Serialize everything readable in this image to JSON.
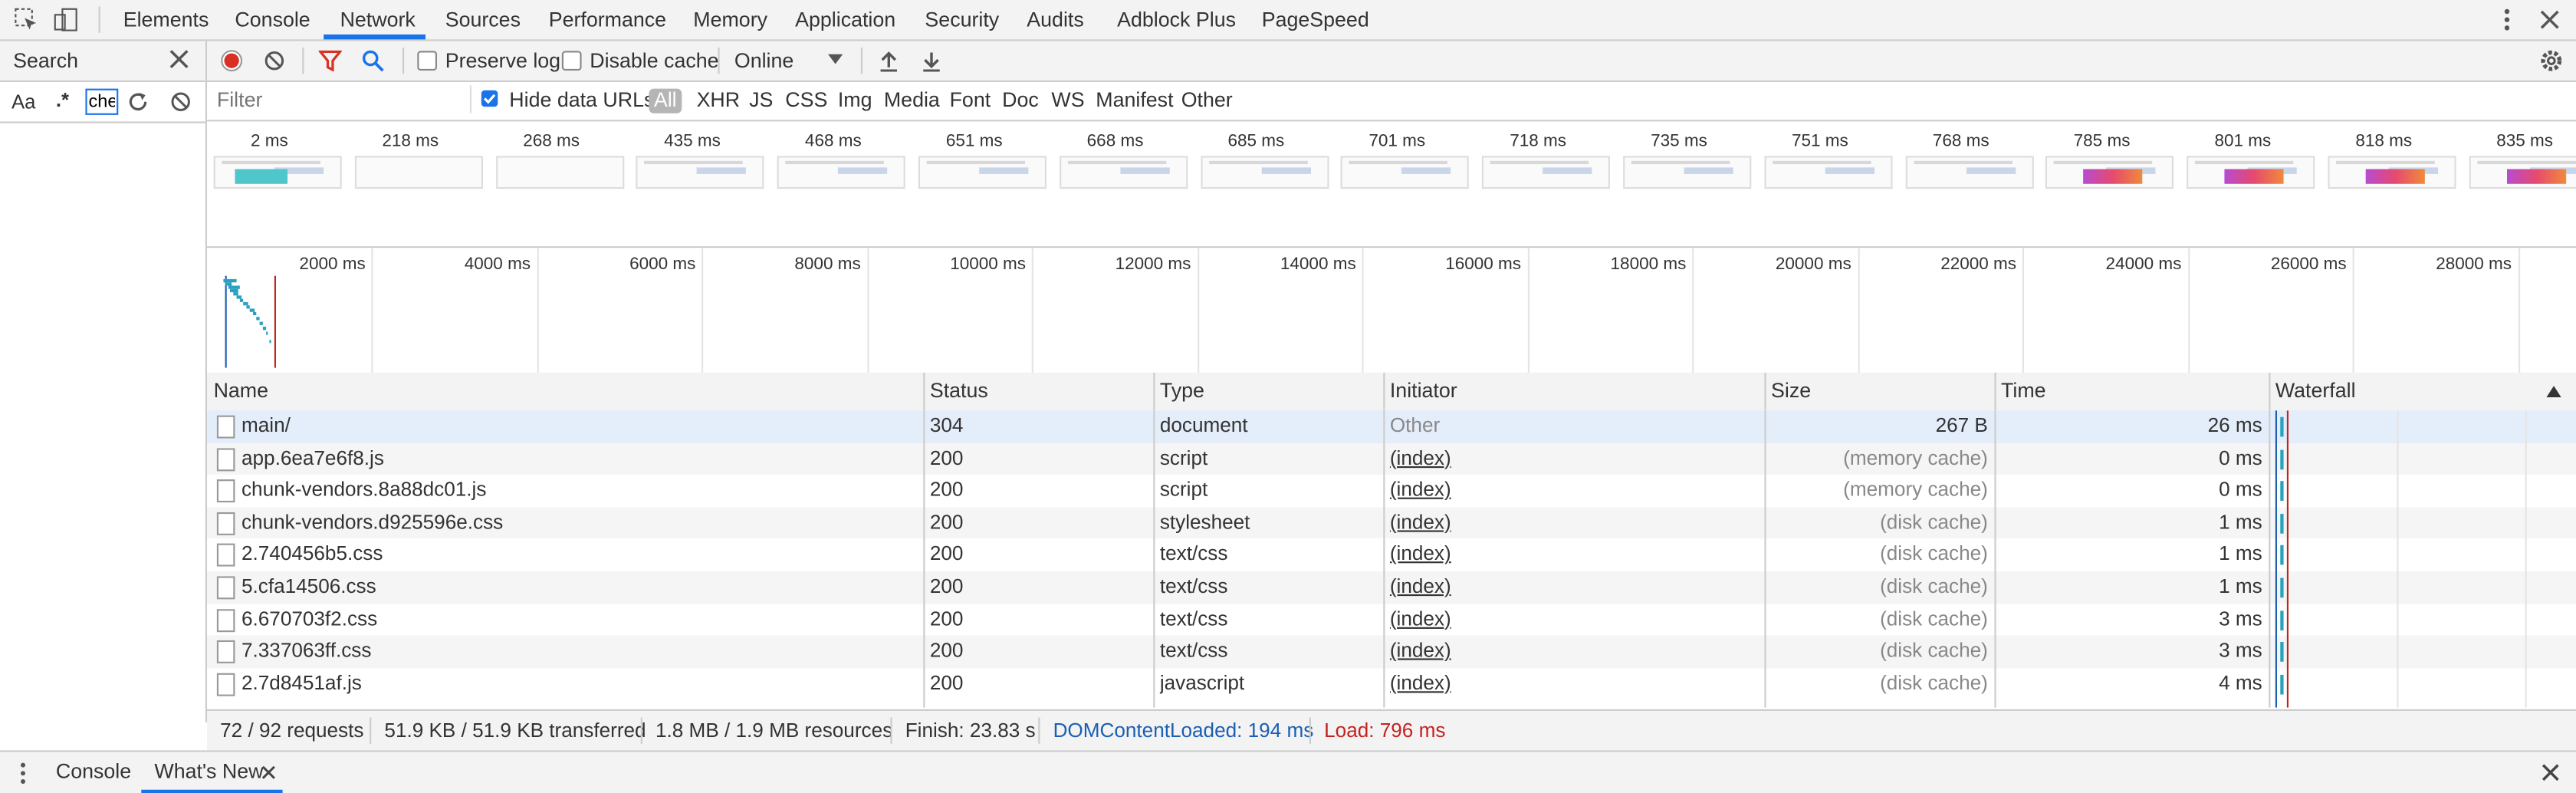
{
  "main_tabs": [
    "Elements",
    "Console",
    "Network",
    "Sources",
    "Performance",
    "Memory",
    "Application",
    "Security",
    "Audits",
    "Adblock Plus",
    "PageSpeed"
  ],
  "active_tab": "Network",
  "search_panel": {
    "title": "Search",
    "case_toggle": "Aa",
    "regex_toggle": ".*",
    "query": "che"
  },
  "network_toolbar": {
    "preserve_log": "Preserve log",
    "preserve_log_checked": false,
    "disable_cache": "Disable cache",
    "disable_cache_checked": false,
    "throttling": "Online"
  },
  "filter_bar": {
    "placeholder": "Filter",
    "hide_data_urls": "Hide data URLs",
    "hide_data_urls_checked": true,
    "types": [
      "All",
      "XHR",
      "JS",
      "CSS",
      "Img",
      "Media",
      "Font",
      "Doc",
      "WS",
      "Manifest",
      "Other"
    ],
    "active_type": "All"
  },
  "screenshots": {
    "times": [
      "2 ms",
      "218 ms",
      "268 ms",
      "435 ms",
      "468 ms",
      "651 ms",
      "668 ms",
      "685 ms",
      "701 ms",
      "718 ms",
      "735 ms",
      "751 ms",
      "768 ms",
      "785 ms",
      "801 ms",
      "818 ms",
      "835 ms"
    ]
  },
  "overview": {
    "ticks": [
      "2000 ms",
      "4000 ms",
      "6000 ms",
      "8000 ms",
      "10000 ms",
      "12000 ms",
      "14000 ms",
      "16000 ms",
      "18000 ms",
      "20000 ms",
      "22000 ms",
      "24000 ms",
      "26000 ms",
      "28000 ms"
    ],
    "dom_content_loaded_ms": 194,
    "load_ms": 796,
    "range_ms": 28700
  },
  "table": {
    "columns": [
      "Name",
      "Status",
      "Type",
      "Initiator",
      "Size",
      "Time",
      "Waterfall"
    ],
    "rows": [
      {
        "name": "main/",
        "status": "304",
        "type": "document",
        "initiator": "Other",
        "size": "267 B",
        "time": "26 ms"
      },
      {
        "name": "app.6ea7e6f8.js",
        "status": "200",
        "type": "script",
        "initiator": "(index)",
        "size": "(memory cache)",
        "time": "0 ms"
      },
      {
        "name": "chunk-vendors.8a88dc01.js",
        "status": "200",
        "type": "script",
        "initiator": "(index)",
        "size": "(memory cache)",
        "time": "0 ms"
      },
      {
        "name": "chunk-vendors.d925596e.css",
        "status": "200",
        "type": "stylesheet",
        "initiator": "(index)",
        "size": "(disk cache)",
        "time": "1 ms"
      },
      {
        "name": "2.740456b5.css",
        "status": "200",
        "type": "text/css",
        "initiator": "(index)",
        "size": "(disk cache)",
        "time": "1 ms"
      },
      {
        "name": "5.cfa14506.css",
        "status": "200",
        "type": "text/css",
        "initiator": "(index)",
        "size": "(disk cache)",
        "time": "1 ms"
      },
      {
        "name": "6.670703f2.css",
        "status": "200",
        "type": "text/css",
        "initiator": "(index)",
        "size": "(disk cache)",
        "time": "3 ms"
      },
      {
        "name": "7.337063ff.css",
        "status": "200",
        "type": "text/css",
        "initiator": "(index)",
        "size": "(disk cache)",
        "time": "3 ms"
      },
      {
        "name": "2.7d8451af.js",
        "status": "200",
        "type": "javascript",
        "initiator": "(index)",
        "size": "(disk cache)",
        "time": "4 ms"
      }
    ]
  },
  "status_bar": {
    "requests": "72 / 92 requests",
    "transferred": "51.9 KB / 51.9 KB transferred",
    "resources": "1.8 MB / 1.9 MB resources",
    "finish": "Finish: 23.83 s",
    "dom_content_loaded": "DOMContentLoaded: 194 ms",
    "load": "Load: 796 ms"
  },
  "drawer": {
    "tabs": [
      "Console",
      "What's New"
    ],
    "active_tab": "What's New"
  },
  "colors": {
    "accent": "#1a73e8",
    "record": "#d93025",
    "dom_content_loaded": "#1a5fb4",
    "load": "#c5221f"
  }
}
